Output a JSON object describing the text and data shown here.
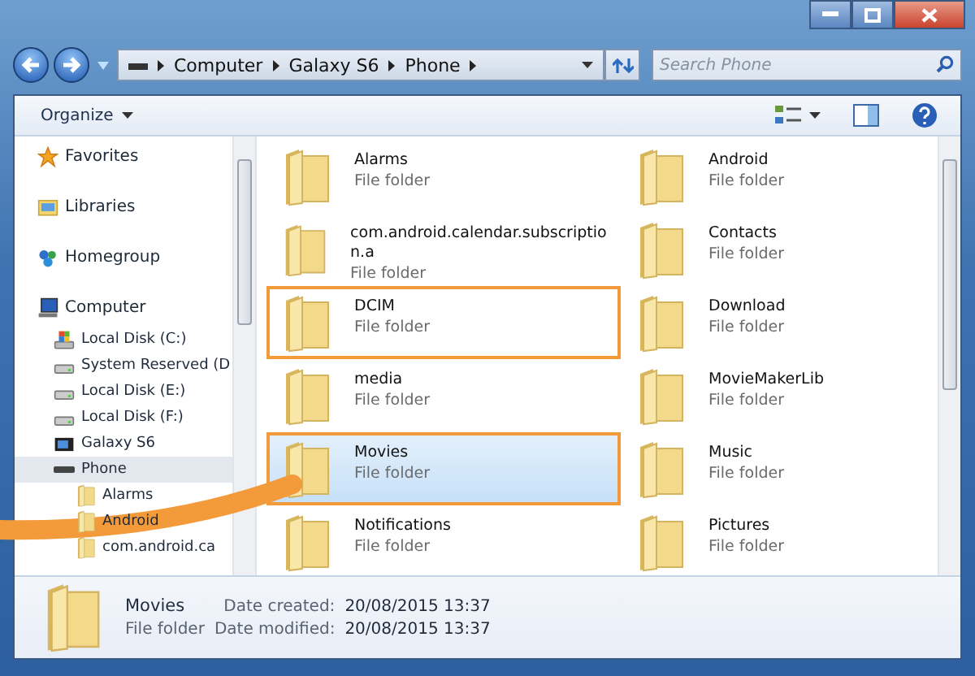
{
  "address_bar": {
    "path": [
      "Computer",
      "Galaxy S6",
      "Phone"
    ]
  },
  "search": {
    "placeholder": "Search Phone"
  },
  "toolbar": {
    "organize": "Organize"
  },
  "nav": [
    {
      "label": "Favorites",
      "kind": "star",
      "selected": false
    },
    {
      "label": "Libraries",
      "kind": "library",
      "selected": false
    },
    {
      "label": "Homegroup",
      "kind": "homegroup",
      "selected": false
    },
    {
      "label": "Computer",
      "kind": "computer",
      "selected": false,
      "children": [
        {
          "label": "Local Disk (C:)",
          "kind": "system-disk",
          "selected": false
        },
        {
          "label": "System Reserved (D",
          "kind": "disk",
          "selected": false
        },
        {
          "label": "Local Disk (E:)",
          "kind": "disk",
          "selected": false
        },
        {
          "label": "Local Disk (F:)",
          "kind": "disk",
          "selected": false
        },
        {
          "label": "Galaxy S6",
          "kind": "device",
          "selected": false
        },
        {
          "label": "Phone",
          "kind": "drive",
          "selected": true,
          "children": [
            {
              "label": "Alarms",
              "kind": "folder",
              "selected": false
            },
            {
              "label": "Android",
              "kind": "folder",
              "selected": false
            },
            {
              "label": "com.android.ca",
              "kind": "folder",
              "selected": false
            }
          ]
        }
      ]
    }
  ],
  "items": [
    {
      "name": "Alarms",
      "type": "File folder",
      "selected": false,
      "highlighted": false
    },
    {
      "name": "Android",
      "type": "File folder",
      "selected": false,
      "highlighted": false
    },
    {
      "name": "com.android.calendar.subscription.a",
      "type": "File folder",
      "selected": false,
      "highlighted": false
    },
    {
      "name": "Contacts",
      "type": "File folder",
      "selected": false,
      "highlighted": false
    },
    {
      "name": "DCIM",
      "type": "File folder",
      "selected": false,
      "highlighted": true
    },
    {
      "name": "Download",
      "type": "File folder",
      "selected": false,
      "highlighted": false
    },
    {
      "name": "media",
      "type": "File folder",
      "selected": false,
      "highlighted": false
    },
    {
      "name": "MovieMakerLib",
      "type": "File folder",
      "selected": false,
      "highlighted": false
    },
    {
      "name": "Movies",
      "type": "File folder",
      "selected": true,
      "highlighted": true
    },
    {
      "name": "Music",
      "type": "File folder",
      "selected": false,
      "highlighted": false
    },
    {
      "name": "Notifications",
      "type": "File folder",
      "selected": false,
      "highlighted": false
    },
    {
      "name": "Pictures",
      "type": "File folder",
      "selected": false,
      "highlighted": false
    }
  ],
  "details": {
    "name": "Movies",
    "type": "File folder",
    "fields": [
      {
        "label": "Date created:",
        "value": "20/08/2015 13:37"
      },
      {
        "label": "Date modified:",
        "value": "20/08/2015 13:37"
      }
    ]
  }
}
